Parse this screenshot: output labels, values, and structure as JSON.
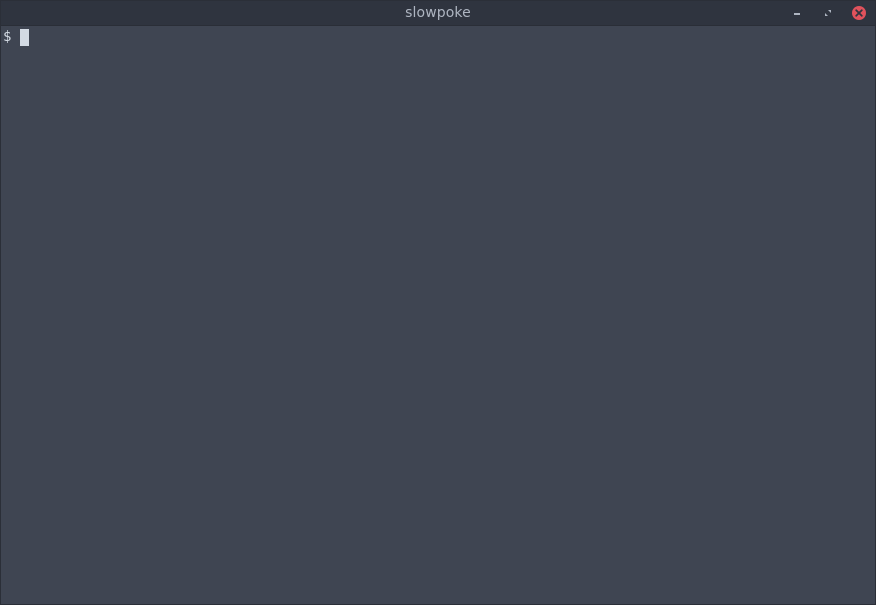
{
  "window": {
    "title": "slowpoke",
    "controls": {
      "minimize_icon": "minimize-icon",
      "maximize_icon": "maximize-icon",
      "close_icon": "close-icon"
    }
  },
  "terminal": {
    "prompt": "$",
    "input": ""
  },
  "colors": {
    "background": "#3f4552",
    "titlebar": "#2f343f",
    "text": "#d3dae3",
    "title_text": "#aeb5c1",
    "close_button": "#e0525c"
  }
}
